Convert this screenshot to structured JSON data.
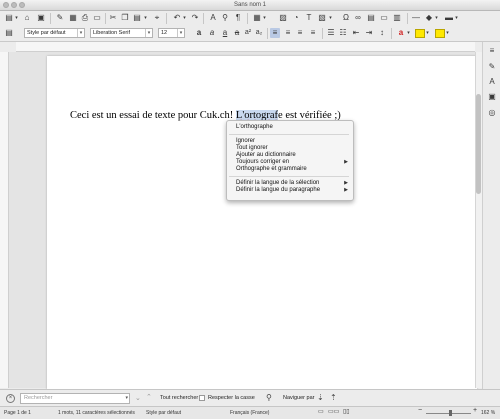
{
  "window": {
    "title": "Sans nom 1"
  },
  "toolbar2": {
    "paragraph_style": "Style par défaut",
    "font_name": "Liberation Serif",
    "font_size": "12"
  },
  "document": {
    "text_before": "Ceci est un essai de texte pour Cuk.ch! ",
    "misspelled": "L'ortograf",
    "cursor": "e",
    "text_after": " est vérifiée ;)"
  },
  "context_menu": {
    "suggestion": "L'orthographe",
    "ignore": "Ignorer",
    "ignore_all": "Tout ignorer",
    "add_to_dictionary": "Ajouter au dictionnaire",
    "always_correct": "Toujours corriger en",
    "spelling_grammar": "Orthographe et grammaire",
    "set_selection_language": "Définir la langue de la sélection",
    "set_paragraph_language": "Définir la langue du paragraphe"
  },
  "findbar": {
    "search_placeholder": "Rechercher",
    "find_all": "Tout rechercher",
    "match_case": "Respecter la casse",
    "navigate_by": "Naviguer par"
  },
  "statusbar": {
    "page": "Page 1 de 1",
    "word_count": "1 mots, 11 caractères sélectionnés",
    "page_style": "Style par défaut",
    "language": "Français (France)",
    "zoom": "162 %"
  },
  "colors": {
    "selection": "#c9d9ef",
    "spell_error": "#d02020",
    "highlight_yellow": "#ffe800"
  }
}
